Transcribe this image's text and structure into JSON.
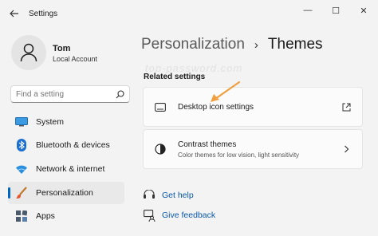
{
  "app": {
    "title": "Settings"
  },
  "window_controls": {
    "minimize": "—",
    "maximize": "☐",
    "close": "✕"
  },
  "profile": {
    "name": "Tom",
    "account_type": "Local Account"
  },
  "search": {
    "placeholder": "Find a setting"
  },
  "nav": {
    "items": [
      {
        "label": "System",
        "icon": "system-icon"
      },
      {
        "label": "Bluetooth & devices",
        "icon": "bluetooth-icon"
      },
      {
        "label": "Network & internet",
        "icon": "wifi-icon"
      },
      {
        "label": "Personalization",
        "icon": "brush-icon",
        "active": true
      },
      {
        "label": "Apps",
        "icon": "apps-icon"
      }
    ]
  },
  "breadcrumb": {
    "parent": "Personalization",
    "separator": "›",
    "current": "Themes"
  },
  "related": {
    "title": "Related settings",
    "desktop_icon": {
      "label": "Desktop icon settings"
    },
    "contrast": {
      "label": "Contrast themes",
      "description": "Color themes for low vision, light sensitivity"
    }
  },
  "links": {
    "get_help": "Get help",
    "give_feedback": "Give feedback"
  },
  "watermark": "top-password.com",
  "colors": {
    "accent": "#0067c0",
    "annotation_arrow": "#f0a040",
    "link": "#0a58a8"
  }
}
